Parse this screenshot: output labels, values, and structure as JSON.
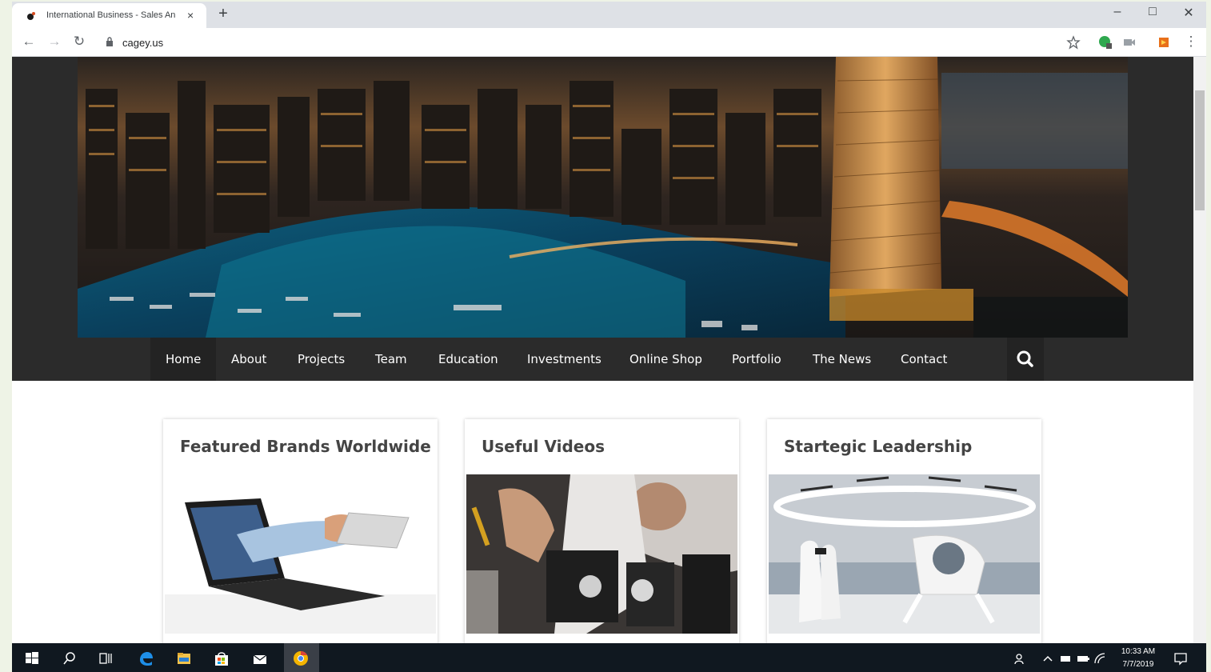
{
  "browser": {
    "tab_title": "International Business - Sales An",
    "tab_close": "×",
    "new_tab": "+",
    "url": "cagey.us",
    "window_controls": {
      "minimize": "–",
      "maximize": "□",
      "close": "✕"
    }
  },
  "nav": {
    "items": [
      "Home",
      "About",
      "Projects",
      "Team",
      "Education",
      "Investments",
      "Online Shop",
      "Portfolio",
      "The News",
      "Contact"
    ],
    "active": "About"
  },
  "cards": [
    {
      "title": "Featured Brands Worldwide",
      "image": "laptop-hand-card-image"
    },
    {
      "title": "Useful Videos",
      "image": "lab-optics-image"
    },
    {
      "title": "Startegic Leadership",
      "image": "drone-taxi-image"
    }
  ],
  "taskbar": {
    "time": "10:33 AM",
    "date": "7/7/2019"
  },
  "colors": {
    "nav_bg": "#2b2b2b",
    "nav_active_bg": "#232323",
    "card_title": "#444444",
    "taskbar_bg": "#101820",
    "desktop_bg": "#eef3e6"
  }
}
